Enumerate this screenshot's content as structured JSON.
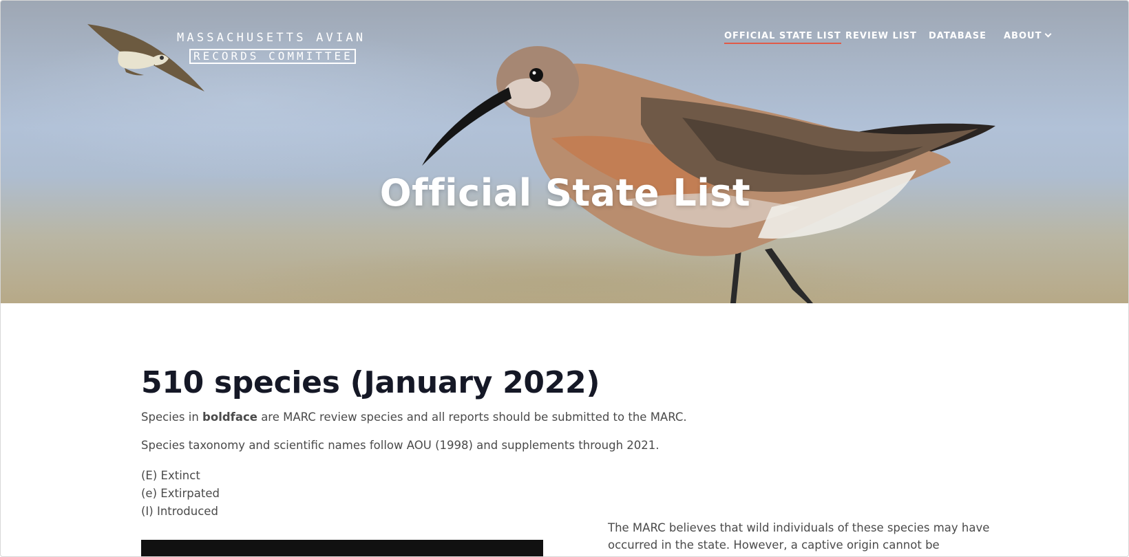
{
  "logo": {
    "line1": "MASSACHUSETTS AVIAN",
    "line2": "RECORDS COMMITTEE"
  },
  "nav": {
    "items": [
      {
        "label": "OFFICIAL STATE LIST",
        "active": true
      },
      {
        "label": "REVIEW LIST",
        "active": false
      },
      {
        "label": "DATABASE",
        "active": false
      },
      {
        "label": "ABOUT",
        "active": false,
        "icon": "chevron-down-icon"
      }
    ],
    "active_underline_color": "#e05a47"
  },
  "hero": {
    "title": "Official State List",
    "image": "shorebird-photo"
  },
  "main": {
    "heading": "510 species (January 2022)",
    "intro_prefix": "Species in ",
    "intro_bold": "boldface",
    "intro_suffix": " are MARC review species  and all reports should be submitted to the MARC.",
    "taxonomy_note": "Species taxonomy and scientific names follow AOU (1998) and supplements through 2021.",
    "legend": [
      "(E) Extinct",
      "(e) Extirpated",
      "(I) Introduced"
    ],
    "side_note": "The MARC believes that wild individuals of these species may have occurred in the state. However, a captive origin cannot be discounted:"
  }
}
